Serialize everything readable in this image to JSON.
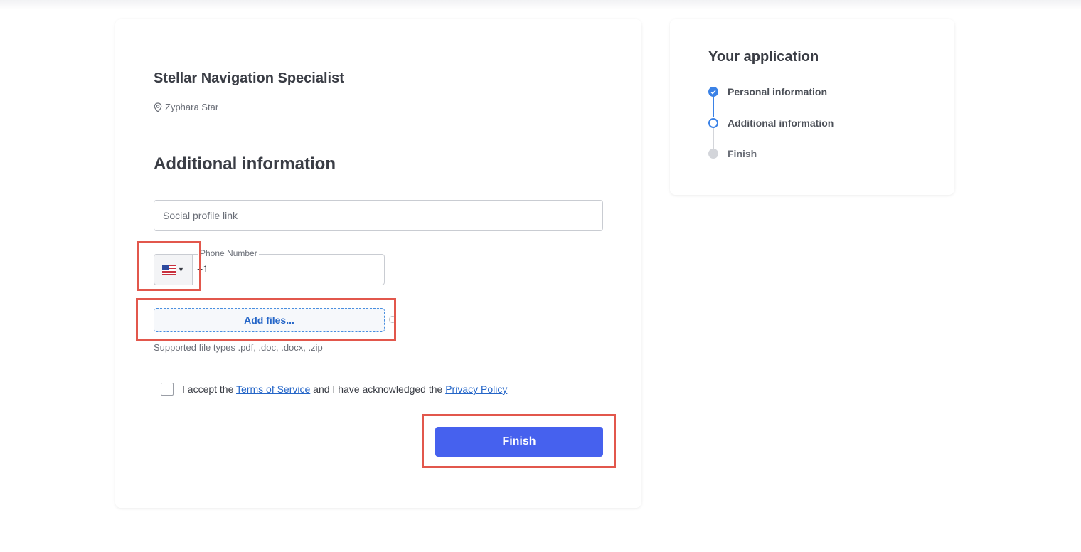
{
  "job": {
    "title": "Stellar Navigation Specialist",
    "location": "Zyphara Star"
  },
  "form": {
    "section_title": "Additional information",
    "social_placeholder": "Social profile link",
    "phone_label": "Phone Number",
    "phone_value": "+1",
    "country_flag": "us-flag-icon",
    "add_files_label": "Add files...",
    "file_hint": "Supported file types .pdf, .doc, .docx, .zip",
    "terms": {
      "prefix": "I accept the",
      "tos_link": "Terms of Service",
      "middle": "and I have acknowledged the",
      "privacy_link": "Privacy Policy",
      "checked": false
    },
    "finish_label": "Finish"
  },
  "sidebar": {
    "title": "Your application",
    "steps": [
      {
        "label": "Personal information",
        "status": "done"
      },
      {
        "label": "Additional information",
        "status": "current"
      },
      {
        "label": "Finish",
        "status": "todo"
      }
    ]
  },
  "colors": {
    "primary_button": "#4661ee",
    "link": "#2566c8",
    "step_active": "#3b82e6",
    "highlight": "#e2574c"
  }
}
